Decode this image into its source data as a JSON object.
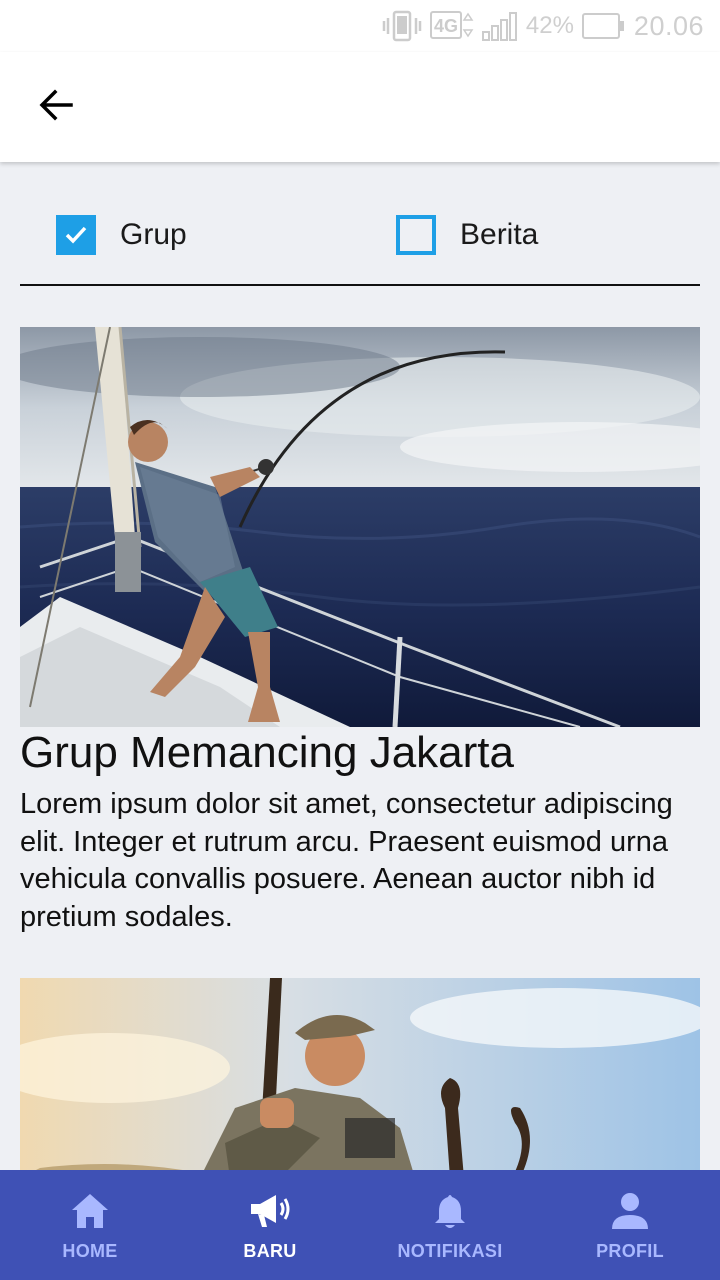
{
  "status_bar": {
    "network": "4G",
    "battery": "42%",
    "time": "20.06"
  },
  "filters": [
    {
      "label": "Grup",
      "checked": true
    },
    {
      "label": "Berita",
      "checked": false
    }
  ],
  "cards": [
    {
      "title": "Grup Memancing Jakarta",
      "description": "Lorem ipsum dolor sit amet, consectetur adipiscing elit. Integer et rutrum arcu. Praesent euismod urna vehicula convallis posuere. Aenean auctor nibh id pretium sodales."
    }
  ],
  "bottom_nav": [
    {
      "label": "HOME",
      "icon": "home-icon",
      "active": false
    },
    {
      "label": "BARU",
      "icon": "megaphone-icon",
      "active": true
    },
    {
      "label": "NOTIFIKASI",
      "icon": "bell-icon",
      "active": false
    },
    {
      "label": "PROFIL",
      "icon": "person-icon",
      "active": false
    }
  ],
  "colors": {
    "accent": "#1e9fe6",
    "nav_background": "#3f51b5",
    "nav_inactive": "#a9b8ff",
    "nav_active": "#ffffff",
    "page_background": "#eef0f4"
  }
}
